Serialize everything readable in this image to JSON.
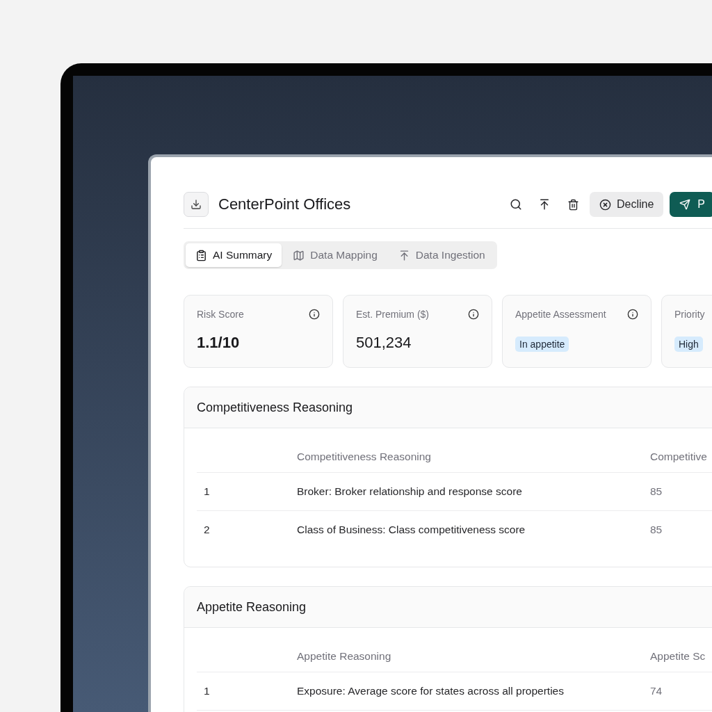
{
  "header": {
    "title": "CenterPoint Offices",
    "actions": [
      {
        "kind": "search"
      },
      {
        "kind": "upload"
      },
      {
        "kind": "delete"
      }
    ],
    "decline_button": {
      "label": "Decline"
    },
    "primary_button": {
      "label": "P"
    }
  },
  "tabs": [
    {
      "label": "AI Summary",
      "selected": true
    },
    {
      "label": "Data Mapping",
      "selected": false
    },
    {
      "label": "Data Ingestion",
      "selected": false
    }
  ],
  "metrics": [
    {
      "kind": "value",
      "label": "Risk Score",
      "value": "1.1/10",
      "bold": true,
      "info": true
    },
    {
      "kind": "value",
      "label": "Est. Premium ($)",
      "value": "501,234",
      "bold": false,
      "info": true
    },
    {
      "kind": "badge",
      "label": "Appetite Assessment",
      "value": "In appetite",
      "info": true
    },
    {
      "kind": "badge",
      "label": "Priority",
      "value": "High"
    }
  ],
  "sections": [
    {
      "title": "Competitiveness Reasoning",
      "columns": [
        "Competitiveness Reasoning",
        "Competitive"
      ],
      "rows": [
        {
          "index": "1",
          "reasoning": "Broker: Broker relationship and response score",
          "score": "85"
        },
        {
          "index": "2",
          "reasoning": "Class of Business: Class competitiveness score",
          "score": "85"
        }
      ]
    },
    {
      "title": "Appetite Reasoning",
      "columns": [
        "Appetite Reasoning",
        "Appetite Sc"
      ],
      "rows": [
        {
          "index": "1",
          "reasoning": "Exposure: Average score for states across all properties",
          "score": "74"
        }
      ]
    }
  ]
}
